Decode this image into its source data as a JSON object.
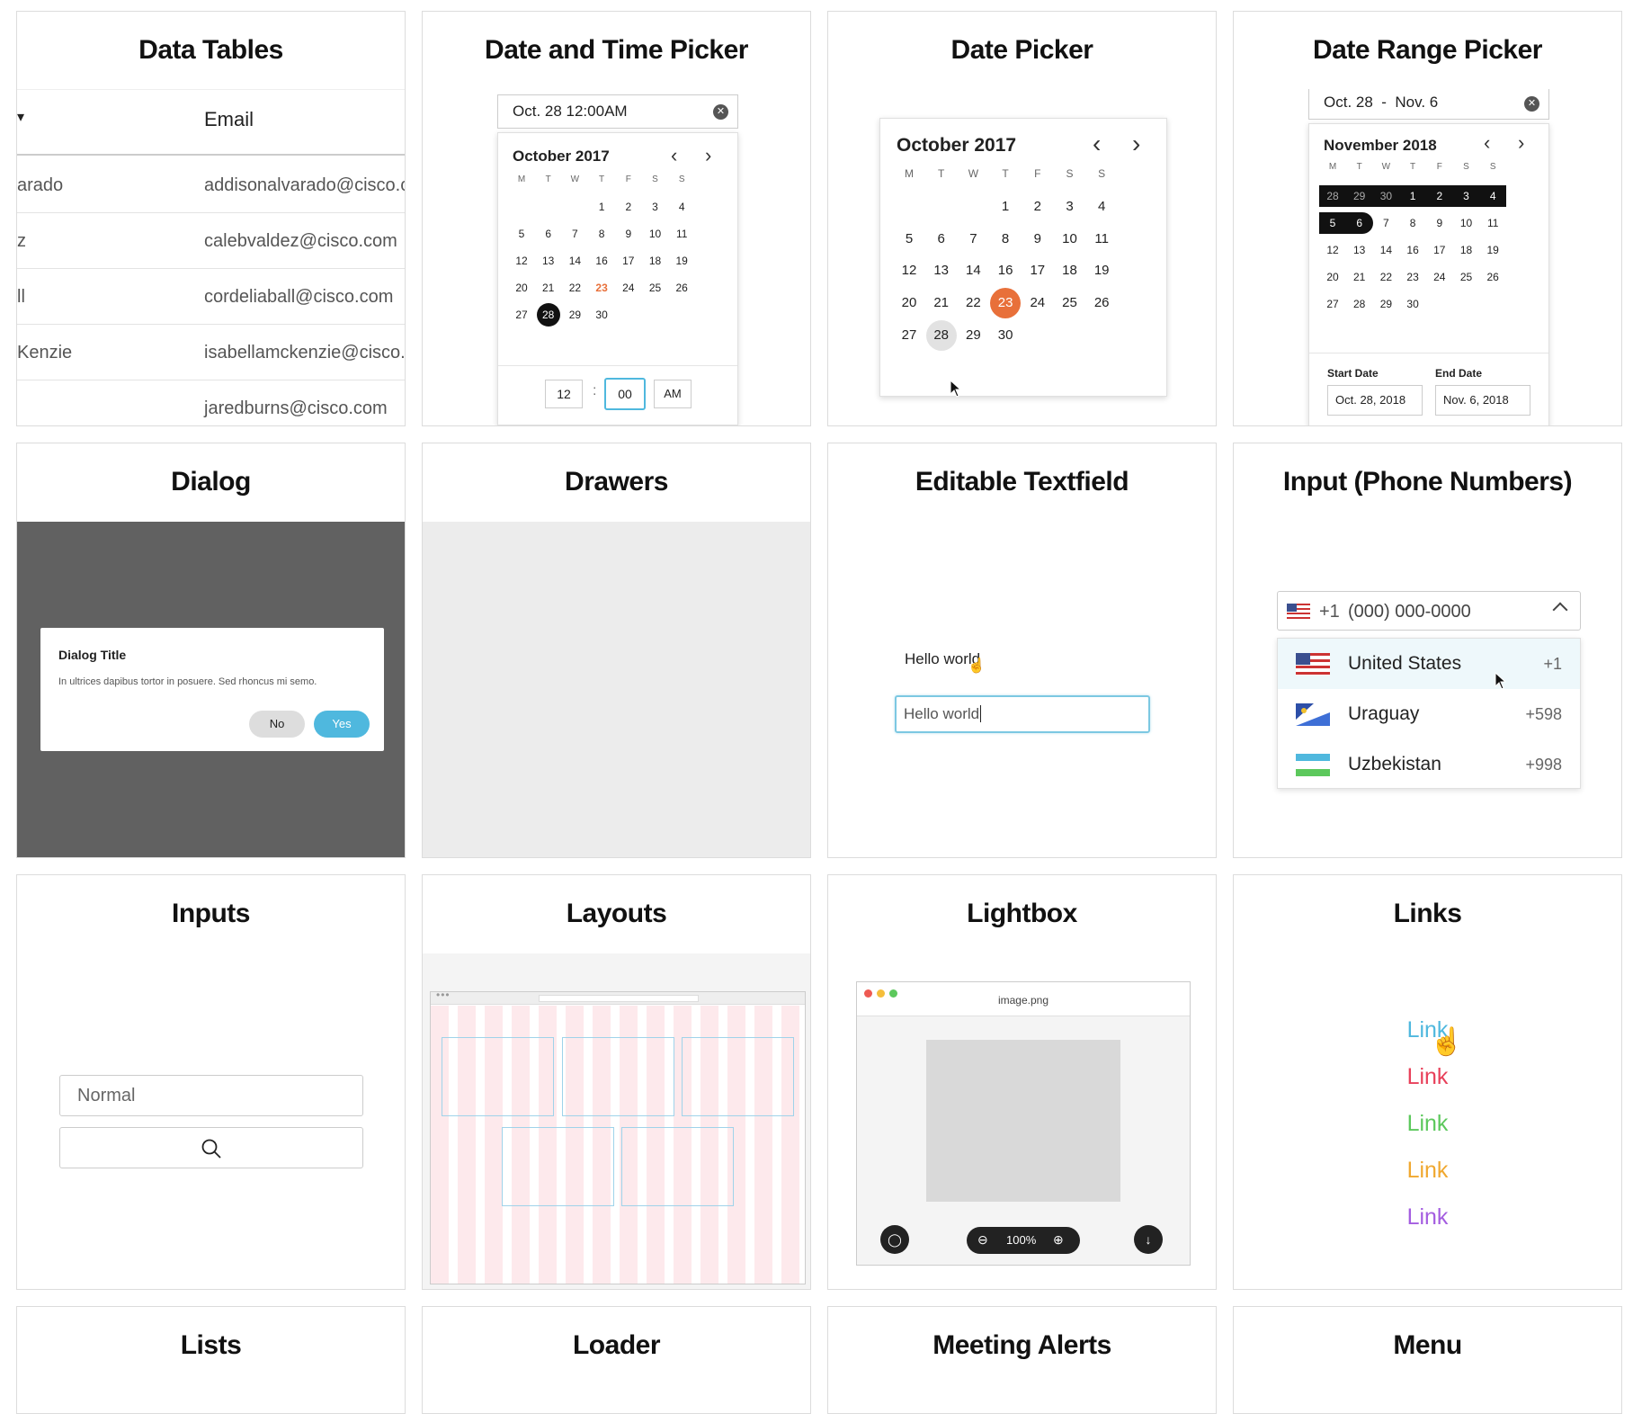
{
  "cards": {
    "data_tables": "Data Tables",
    "date_time_picker": "Date and Time Picker",
    "date_picker": "Date Picker",
    "date_range_picker": "Date Range Picker",
    "dialog": "Dialog",
    "drawers": "Drawers",
    "editable_textfield": "Editable Textfield",
    "input_phone": "Input (Phone Numbers)",
    "inputs": "Inputs",
    "layouts": "Layouts",
    "lightbox": "Lightbox",
    "links": "Links",
    "lists": "Lists",
    "loader": "Loader",
    "meeting_alerts": "Meeting Alerts",
    "menu": "Menu"
  },
  "data_table": {
    "header_email": "Email",
    "header_sort_icon": "sort-arrow-icon",
    "rows": [
      {
        "name": "arado",
        "email": "addisonalvarado@cisco.c"
      },
      {
        "name": "z",
        "email": "calebvaldez@cisco.com"
      },
      {
        "name": "ll",
        "email": "cordeliaball@cisco.com"
      },
      {
        "name": "Kenzie",
        "email": "isabellamckenzie@cisco."
      },
      {
        "name": "",
        "email": "jaredburns@cisco.com"
      }
    ]
  },
  "dtp": {
    "value": "Oct. 28 12:00AM",
    "month": "October 2017",
    "weekdays": [
      "M",
      "T",
      "W",
      "T",
      "F",
      "S",
      "S"
    ],
    "days": [
      "1",
      "2",
      "3",
      "4",
      "5",
      "6",
      "7",
      "8",
      "9",
      "10",
      "11",
      "12",
      "13",
      "14",
      "16",
      "17",
      "18",
      "19",
      "20",
      "21",
      "22",
      "23",
      "24",
      "25",
      "26",
      "27",
      "28",
      "29",
      "30"
    ],
    "hour": "12",
    "colon": ":",
    "minute": "00",
    "ampm": "AM"
  },
  "dp": {
    "month": "October 2017",
    "weekdays": [
      "M",
      "T",
      "W",
      "T",
      "F",
      "S",
      "S"
    ],
    "days": [
      "1",
      "2",
      "3",
      "4",
      "5",
      "6",
      "7",
      "8",
      "9",
      "10",
      "11",
      "12",
      "13",
      "14",
      "16",
      "17",
      "18",
      "19",
      "20",
      "21",
      "22",
      "23",
      "24",
      "25",
      "26",
      "27",
      "28",
      "29",
      "30"
    ]
  },
  "drp": {
    "value": "Oct. 28  -  Nov. 6",
    "month": "November 2018",
    "weekdays": [
      "M",
      "T",
      "W",
      "T",
      "F",
      "S",
      "S"
    ],
    "days": [
      "28",
      "29",
      "30",
      "1",
      "2",
      "3",
      "4",
      "5",
      "6",
      "7",
      "8",
      "9",
      "10",
      "11",
      "12",
      "13",
      "14",
      "16",
      "17",
      "18",
      "19",
      "20",
      "21",
      "22",
      "23",
      "24",
      "25",
      "26",
      "27",
      "28",
      "29",
      "30"
    ],
    "start_label": "Start Date",
    "end_label": "End Date",
    "start_value": "Oct. 28, 2018",
    "end_value": "Nov. 6, 2018"
  },
  "dialog": {
    "title": "Dialog Title",
    "body": "In ultrices dapibus tortor in posuere. Sed rhoncus mi semo.",
    "no": "No",
    "yes": "Yes"
  },
  "editable": {
    "label_text": "Hello world",
    "input_value": "Hello world"
  },
  "phone": {
    "prefix": "+1",
    "placeholder": "(000) 000-0000",
    "countries": [
      {
        "name": "United States",
        "code": "+1"
      },
      {
        "name": "Uraguay",
        "code": "+598"
      },
      {
        "name": "Uzbekistan",
        "code": "+998"
      }
    ]
  },
  "inputs": {
    "normal_value": "Normal"
  },
  "lightbox": {
    "filename": "image.png",
    "zoom": "100%"
  },
  "links": [
    "Link",
    "Link",
    "Link",
    "Link",
    "Link"
  ],
  "colors": {
    "accent_blue": "#4fb8de",
    "today_orange": "#e8703a",
    "link_blue": "#4fb8de",
    "link_red": "#e8405a",
    "link_green": "#5cc85c",
    "link_orange": "#f0a830",
    "link_purple": "#a45de0",
    "dialog_overlay": "#616161"
  }
}
